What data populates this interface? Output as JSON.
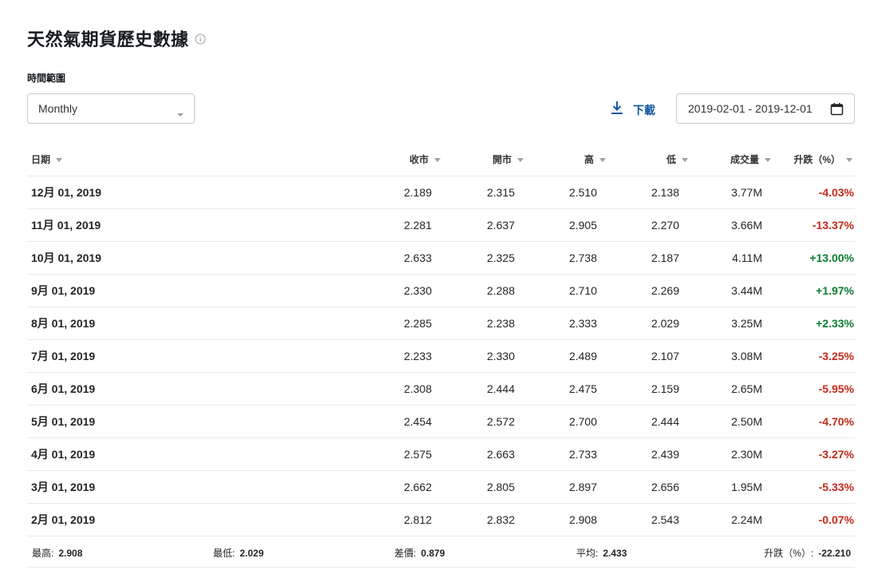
{
  "page": {
    "title": "天然氣期貨歷史數據"
  },
  "filters": {
    "range_label": "時間範圍",
    "timeframe": "Monthly",
    "download_label": "下載",
    "date_range": "2019-02-01 - 2019-12-01"
  },
  "table": {
    "headers": [
      "日期",
      "收市",
      "開市",
      "高",
      "低",
      "成交量",
      "升跌（%）"
    ],
    "rows": [
      {
        "date": "12月 01, 2019",
        "close": "2.189",
        "open": "2.315",
        "high": "2.510",
        "low": "2.138",
        "volume": "3.77M",
        "change": "-4.03%",
        "trend": "down"
      },
      {
        "date": "11月 01, 2019",
        "close": "2.281",
        "open": "2.637",
        "high": "2.905",
        "low": "2.270",
        "volume": "3.66M",
        "change": "-13.37%",
        "trend": "down"
      },
      {
        "date": "10月 01, 2019",
        "close": "2.633",
        "open": "2.325",
        "high": "2.738",
        "low": "2.187",
        "volume": "4.11M",
        "change": "+13.00%",
        "trend": "up"
      },
      {
        "date": "9月 01, 2019",
        "close": "2.330",
        "open": "2.288",
        "high": "2.710",
        "low": "2.269",
        "volume": "3.44M",
        "change": "+1.97%",
        "trend": "up"
      },
      {
        "date": "8月 01, 2019",
        "close": "2.285",
        "open": "2.238",
        "high": "2.333",
        "low": "2.029",
        "volume": "3.25M",
        "change": "+2.33%",
        "trend": "up"
      },
      {
        "date": "7月 01, 2019",
        "close": "2.233",
        "open": "2.330",
        "high": "2.489",
        "low": "2.107",
        "volume": "3.08M",
        "change": "-3.25%",
        "trend": "down"
      },
      {
        "date": "6月 01, 2019",
        "close": "2.308",
        "open": "2.444",
        "high": "2.475",
        "low": "2.159",
        "volume": "2.65M",
        "change": "-5.95%",
        "trend": "down"
      },
      {
        "date": "5月 01, 2019",
        "close": "2.454",
        "open": "2.572",
        "high": "2.700",
        "low": "2.444",
        "volume": "2.50M",
        "change": "-4.70%",
        "trend": "down"
      },
      {
        "date": "4月 01, 2019",
        "close": "2.575",
        "open": "2.663",
        "high": "2.733",
        "low": "2.439",
        "volume": "2.30M",
        "change": "-3.27%",
        "trend": "down"
      },
      {
        "date": "3月 01, 2019",
        "close": "2.662",
        "open": "2.805",
        "high": "2.897",
        "low": "2.656",
        "volume": "1.95M",
        "change": "-5.33%",
        "trend": "down"
      },
      {
        "date": "2月 01, 2019",
        "close": "2.812",
        "open": "2.832",
        "high": "2.908",
        "low": "2.543",
        "volume": "2.24M",
        "change": "-0.07%",
        "trend": "down"
      }
    ]
  },
  "summary": {
    "high_label": "最高:",
    "high_value": "2.908",
    "low_label": "最低:",
    "low_value": "2.029",
    "diff_label": "差價:",
    "diff_value": "0.879",
    "avg_label": "平均:",
    "avg_value": "2.433",
    "change_label": "升跌（%）:",
    "change_value": "-22.210"
  },
  "colors": {
    "up": "#0a7d32",
    "down": "#c4291a",
    "link": "#1256a0"
  },
  "icons": {
    "info": "info-icon",
    "select_caret": "chevron-down-icon",
    "download": "download-icon",
    "calendar": "calendar-icon",
    "sort": "sort-desc-icon"
  }
}
